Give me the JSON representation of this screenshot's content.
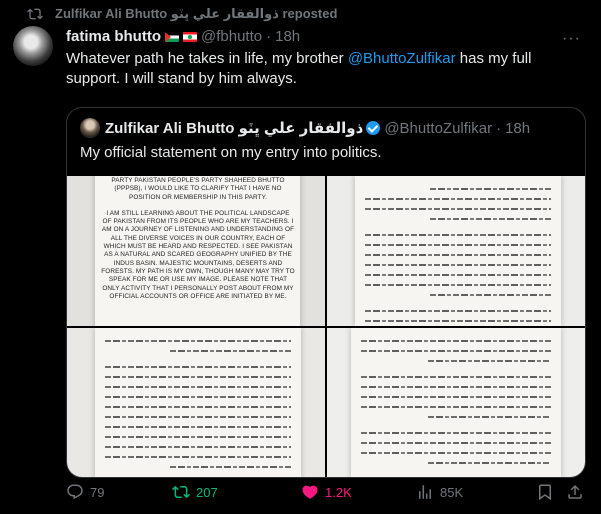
{
  "repost": {
    "text": "Zulfikar Ali Bhutto ذوالفقار علي ڀٽو reposted"
  },
  "tweet": {
    "name": "fatima bhutto",
    "handle": "@fbhutto",
    "dot": "·",
    "time": "18h",
    "text_before": "Whatever path he takes in life, my brother ",
    "mention": "@BhuttoZulfikar",
    "text_after": " has my full support. I will stand by him always."
  },
  "quote": {
    "name": "Zulfikar Ali Bhutto ذوالفقار علي ڀٽو",
    "handle": "@BhuttoZulfikar",
    "dot": "·",
    "time": "18h",
    "text": "My official statement on my entry into politics.",
    "doc_para1": "Party Pakistan People's Party Shaheed Bhutto (PPPSB), I would like to clarify that I have no position or membership in this party.",
    "doc_para2": "I am still learning about the political landscape of Pakistan from its people who are my teachers. I am on a journey of listening and understanding of all the diverse voices in our country, each of which must be heard and respected. I see Pakistan as a natural and scared geography unified by the Indus Basin. Majestic mountains, deserts and forests. My path is my own, though many may try to speak for me or use my image. Please note that only activity that I personally post about from my official accounts or office are initiated by me."
  },
  "actions": {
    "replies": "79",
    "reposts": "207",
    "likes": "1.2K",
    "views": "85K"
  },
  "colors": {
    "accent": "#1d9bf0",
    "repost": "#00ba7c",
    "like": "#f91880",
    "muted": "#71767b"
  }
}
